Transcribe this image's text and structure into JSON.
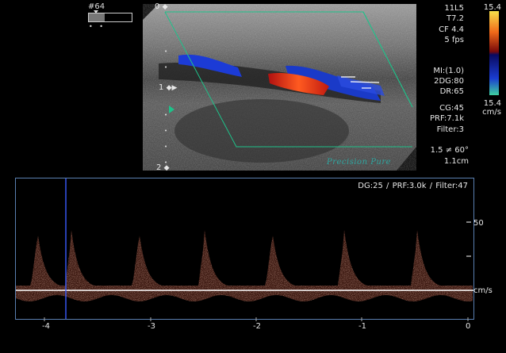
{
  "header": {
    "frame_id": "#64"
  },
  "depth_scale": {
    "top": "0",
    "mid": "1",
    "bottom": "2"
  },
  "params": {
    "probe": "11L5",
    "t": "T7.2",
    "cf": "CF 4.4",
    "fps": "5 fps",
    "mi": "MI:(1.0)",
    "dg2d": "2DG:80",
    "dr": "DR:65",
    "cg": "CG:45",
    "prf": "PRF:7.1k",
    "filter": "Filter:3"
  },
  "color_bar": {
    "top_label": "15.4",
    "bottom_label": "15.4",
    "unit": "cm/s",
    "colors": {
      "positive_top": "#f7e04a",
      "positive": "#e0301a",
      "negative": "#1a3cd0",
      "negative_bottom": "#3ed0a0"
    }
  },
  "angle": {
    "value": "1.5 ≠ 60°",
    "size": "1.1cm"
  },
  "watermark": "Precision Pure",
  "spectral": {
    "header": "DG:25 /  PRF:3.0k  / Filter:47",
    "scale_label": "50",
    "unit": "cm/s",
    "x_ticks": [
      "-4",
      "-3",
      "-2",
      "-1",
      "0"
    ]
  }
}
